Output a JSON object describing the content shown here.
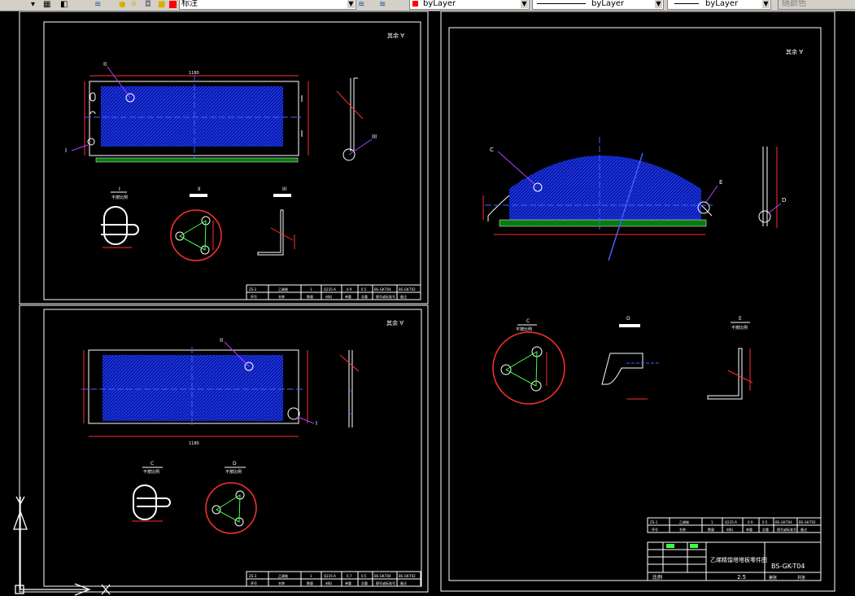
{
  "toolbar": {
    "layer_name": "标注",
    "color_value": "byLayer",
    "linetype_value": "byLayer",
    "lineweight_value": "byLayer",
    "plotstyle_value": "随颜色",
    "layer_color": "#ff0000"
  },
  "drawing": {
    "tables": {
      "left_top": {
        "row1": [
          "ZS-2",
          "乙烯制",
          "1",
          "Q235-A",
          "0.9",
          "0.5",
          "BS-GK-T04",
          "BS-GK-T02"
        ],
        "row2": [
          "序号",
          "名称",
          "数量",
          "材料",
          "单重",
          "总重",
          "图号或标准号",
          "备注"
        ]
      },
      "left_bottom": {
        "row1": [
          "ZS-3",
          "乙烯制",
          "1",
          "Q235-A",
          "0.7",
          "0.5",
          "BS-GK-T04",
          "BS-GK-T02"
        ],
        "row2": [
          "序号",
          "名称",
          "数量",
          "材料",
          "单重",
          "总重",
          "图号或标准号",
          "备注"
        ]
      },
      "right": {
        "row1": [
          "ZS-1",
          "乙烯制",
          "1",
          "Q235-A",
          "0.9",
          "0.5",
          "BS-GK-T04",
          "BS-GK-T02"
        ],
        "row2": [
          "序号",
          "名称",
          "数量",
          "材料",
          "单重",
          "总重",
          "图号或标准号",
          "备注"
        ]
      }
    },
    "title_block": {
      "title": "乙烯精馏塔塔板零件图",
      "drawing_no": "BS-GK-T04",
      "scale_label": "比例",
      "scale_value": "2.5",
      "sheet_label": "第张",
      "total_label": "共张"
    },
    "labels": {
      "view_i": "I",
      "view_ii": "II",
      "view_iii": "III",
      "view_c": "C",
      "view_d": "D",
      "view_e": "E",
      "rotate_note": "不按比例"
    }
  }
}
